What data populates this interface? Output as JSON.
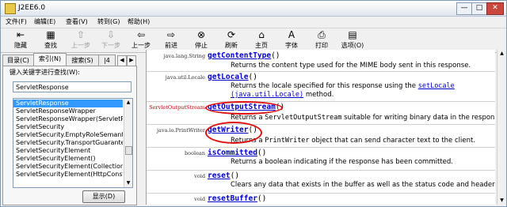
{
  "window": {
    "title": "J2EE6.0",
    "buttons": [
      "—",
      "□",
      "✕"
    ]
  },
  "menu": [
    "文件(F)",
    "编辑(E)",
    "查看(V)",
    "转到(G)",
    "帮助(H)"
  ],
  "toolbar": [
    {
      "label": "隐藏",
      "icon": "⇤",
      "enabled": true
    },
    {
      "label": "查找",
      "icon": "▦",
      "enabled": true
    },
    {
      "label": "上一步",
      "icon": "⇧",
      "enabled": false
    },
    {
      "label": "下一步",
      "icon": "⇩",
      "enabled": false
    },
    {
      "label": "上一步",
      "icon": "⇦",
      "enabled": true
    },
    {
      "label": "前进",
      "icon": "⇨",
      "enabled": true
    },
    {
      "label": "停止",
      "icon": "⊗",
      "enabled": true
    },
    {
      "label": "刷新",
      "icon": "⟳",
      "enabled": true
    },
    {
      "label": "主页",
      "icon": "⌂",
      "enabled": true
    },
    {
      "label": "字体",
      "icon": "A",
      "enabled": true
    },
    {
      "label": "打印",
      "icon": "⎙",
      "enabled": true
    },
    {
      "label": "选项(O)",
      "icon": "▤",
      "enabled": true
    }
  ],
  "tabs": [
    "目录(C)",
    "索引(N)",
    "搜索(S)",
    "|4"
  ],
  "tab_scroll": [
    "◀",
    "▶"
  ],
  "search": {
    "label": "键入关键字进行查找(W):",
    "value": "ServletResponse"
  },
  "list": {
    "items": [
      "ServletResponse",
      "ServletResponseWrapper",
      "ServletResponseWrapper(ServletR",
      "ServletSecurity",
      "ServletSecurity.EmptyRoleSemantic",
      "ServletSecurity.TransportGuarantee",
      "ServletSecurityElement",
      "ServletSecurityElement()",
      "ServletSecurityElement(Collection<",
      "ServletSecurityElement(HttpConstr"
    ],
    "selected": 0
  },
  "show_button": "显示(D)",
  "content": {
    "rows": [
      {
        "type": "java.lang.String",
        "method": "getContentType",
        "params": "()",
        "desc": "Returns the content type used for the MIME body sent in this response."
      },
      {
        "type": "java.util.Locale",
        "method": "getLocale",
        "params": "()",
        "desc_parts": [
          "Returns the locale specified for this response using the ",
          "setLocale",
          "(java.util.Locale)",
          " method."
        ]
      },
      {
        "type": "ServletOutputStream",
        "method": "getOutputStream",
        "params": "()",
        "desc_parts": [
          "Returns a ",
          "ServletOutputStream",
          " suitable for writing binary data in the response."
        ]
      },
      {
        "type": "java.io.PrintWriter",
        "method": "getWriter",
        "params": "()",
        "desc_parts": [
          "Returns a ",
          "PrintWriter",
          " object that can send character text to the client."
        ]
      },
      {
        "type": "boolean",
        "method": "isCommitted",
        "params": "()",
        "desc": "Returns a boolean indicating if the response has been committed."
      },
      {
        "type": "void",
        "method": "reset",
        "params": "()",
        "desc": "Clears any data that exists in the buffer as well as the status code and headers."
      },
      {
        "type": "void",
        "method": "resetBuffer",
        "params": "()",
        "desc": ""
      }
    ]
  },
  "scroll_arrows": {
    "up": "▲",
    "down": "▼"
  }
}
